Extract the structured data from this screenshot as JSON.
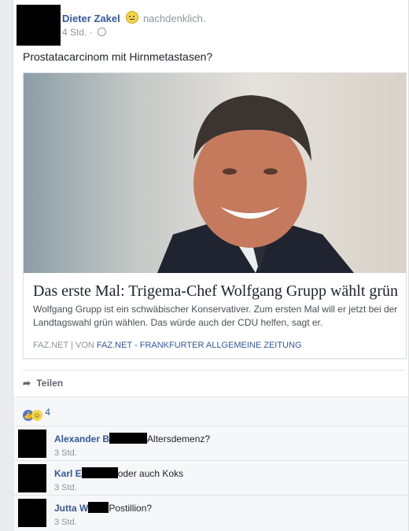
{
  "post": {
    "author": "Dieter Zakel",
    "feeling": "nachdenklich.",
    "time": "4 Std. ·",
    "text": "Prostatacarcinom mit Hirnmetastasen?"
  },
  "link": {
    "headline": "Das erste Mal: Trigema-Chef Wolfgang Grupp wählt grün",
    "description": "Wolfgang Grupp ist ein schwäbischer Konservativer. Zum ersten Mal will er jetzt bei der Landtagswahl grün wählen. Das würde auch der CDU helfen, sagt er.",
    "source_domain": "FAZ.NET",
    "source_sep": "|",
    "source_prefix": "VON",
    "source_name": "FAZ.NET - FRANKFURTER ALLGEMEINE ZEITUNG"
  },
  "actions": {
    "share": "Teilen"
  },
  "reactions": {
    "count": "4"
  },
  "comments": [
    {
      "author": "Alexander B",
      "text": "Altersdemenz?",
      "time": "3 Std."
    },
    {
      "author": "Karl E",
      "text": "oder auch Koks",
      "time": "3 Std."
    },
    {
      "author": "Jutta W",
      "text": "Postillion?",
      "time": "3 Std."
    }
  ]
}
